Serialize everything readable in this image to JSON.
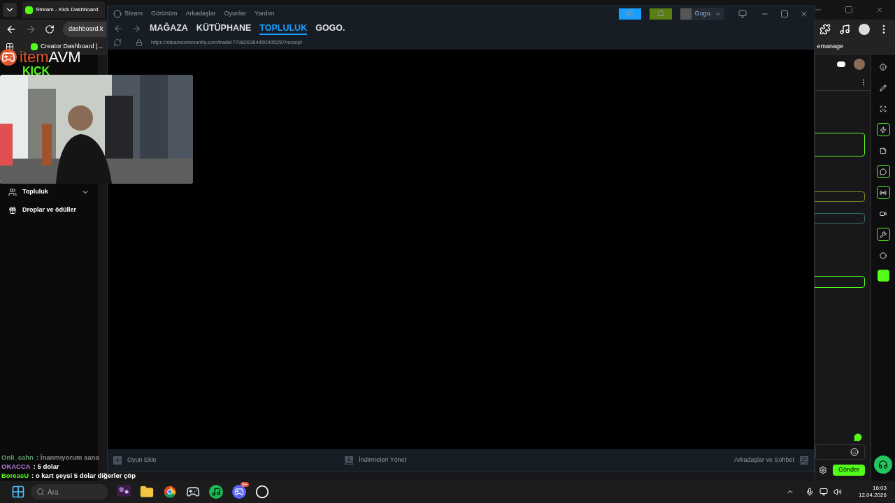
{
  "browser": {
    "tab_title": "Stream - Kick Dashboard",
    "address": "dashboard.k",
    "bookmarks": [
      "Creator Dashboard |...",
      "emanage"
    ],
    "sidebar": [
      {
        "label": "Topluluk",
        "kind": "group"
      },
      {
        "label": "Droplar ve ödüller",
        "kind": "link"
      }
    ],
    "send_label": "Gönder",
    "tools": [
      {
        "kind": "info",
        "highlighted": false
      },
      {
        "kind": "edit",
        "highlighted": false
      },
      {
        "kind": "scan",
        "highlighted": false
      },
      {
        "kind": "bolt",
        "highlighted": true
      },
      {
        "kind": "note",
        "highlighted": false
      },
      {
        "kind": "chat",
        "highlighted": true
      },
      {
        "kind": "radio",
        "highlighted": true
      },
      {
        "kind": "camera",
        "highlighted": false
      },
      {
        "kind": "wrench",
        "highlighted": true
      },
      {
        "kind": "dots",
        "highlighted": false
      },
      {
        "kind": "app",
        "highlighted": false
      }
    ]
  },
  "steam": {
    "menu": [
      "Steam",
      "Görünüm",
      "Arkadaşlar",
      "Oyunlar",
      "Yardım"
    ],
    "nav": [
      {
        "label": "MAĞAZA",
        "selected": false
      },
      {
        "label": "KÜTÜPHANE",
        "selected": false
      },
      {
        "label": "TOPLULUK",
        "selected": true
      },
      {
        "label": "GOGO.",
        "selected": false
      }
    ],
    "user": "Gogo.",
    "url": "https://steamcommunity.com/trade/779826364450905257/receipt",
    "footer": {
      "add_game": "Oyun Ekle",
      "downloads": "İndirmeleri Yönet",
      "friends": "Arkadaşlar ve Sohbet"
    }
  },
  "overlay": {
    "logo_item": "item",
    "logo_avm": "AVM",
    "logo_kick": "KICK",
    "chat": [
      {
        "user": "Onli_cahn",
        "text": ": İnanmıyorum sana",
        "color": "#5f9a6c",
        "faded": true
      },
      {
        "user": "OKACCA",
        "text": ": 5 dolar",
        "color": "#b57edc",
        "faded": false
      },
      {
        "user": "BoreasU",
        "text": ": o kart şeysi 5 dolar diğerler çöp",
        "color": "#53fc18",
        "faded": false
      }
    ]
  },
  "taskbar": {
    "search": "Ara",
    "apps": [
      {
        "kind": "picture"
      },
      {
        "kind": "folder"
      },
      {
        "kind": "chrome"
      },
      {
        "kind": "steam"
      },
      {
        "kind": "spotify"
      },
      {
        "kind": "discord",
        "badge": "9+"
      },
      {
        "kind": "obs"
      }
    ],
    "time": "16:03",
    "date": "12.04.2026"
  }
}
